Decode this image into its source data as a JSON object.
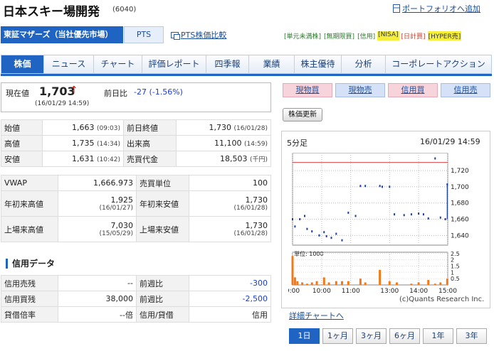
{
  "header": {
    "title": "日本スキー場開発",
    "code": "(6040)",
    "portfolio_link": "ポートフォリオへ追加"
  },
  "market": {
    "tab": "東証マザーズ（当社優先市場）",
    "pts_tab": "PTS",
    "pts_compare": "PTS株価比較"
  },
  "badges": [
    {
      "label": "[単元未満株]",
      "style": "g"
    },
    {
      "label": "[無期限買]",
      "style": "g"
    },
    {
      "label": "[信用]",
      "style": "g"
    },
    {
      "label": "[NISA]",
      "style": "y"
    },
    {
      "label": "[日計買]",
      "style": "r"
    },
    {
      "label": "[HYPER売]",
      "style": "y"
    }
  ],
  "nav": [
    "株価",
    "ニュース",
    "チャート",
    "評価レポート",
    "四季報",
    "業績",
    "株主優待",
    "分析",
    "コーポレートアクション"
  ],
  "price": {
    "label": "現在値",
    "value": "1,703",
    "arrow": "↑",
    "time": "(16/01/29 14:59)",
    "change_label": "前日比",
    "change_value": "-27 (-1.56%)"
  },
  "trade_buttons": {
    "spot_buy": "現物買",
    "spot_sell": "現物売",
    "margin_buy": "信用買",
    "margin_sell": "信用売"
  },
  "refresh": "株価更新",
  "quote_table": [
    {
      "l1": "始値",
      "v1": "1,663",
      "t1": "(09:03)",
      "l2": "前日終値",
      "v2": "1,730",
      "t2": "(16/01/28)"
    },
    {
      "l1": "高値",
      "v1": "1,735",
      "t1": "(14:34)",
      "l2": "出来高",
      "v2": "11,100",
      "t2": "(14:59)"
    },
    {
      "l1": "安値",
      "v1": "1,631",
      "t1": "(10:42)",
      "l2": "売買代金",
      "v2": "18,503",
      "t2": "(千円)"
    }
  ],
  "stats": {
    "vwap_label": "VWAP",
    "vwap": "1,666.973",
    "unit_label": "売買単位",
    "unit": "100",
    "ytd_high_label": "年初来高値",
    "ytd_high": "1,925",
    "ytd_high_date": "(16/01/27)",
    "ytd_low_label": "年初来安値",
    "ytd_low": "1,730",
    "ytd_low_date": "(16/01/28)",
    "listed_high_label": "上場来高値",
    "listed_high": "7,030",
    "listed_high_date": "(15/05/29)",
    "listed_low_label": "上場来安値",
    "listed_low": "1,730",
    "listed_low_date": "(16/01/28)"
  },
  "credit": {
    "heading": "信用データ",
    "sell_label": "信用売残",
    "sell": "--",
    "sell_wow_label": "前週比",
    "sell_wow": "-300",
    "buy_label": "信用買残",
    "buy": "38,000",
    "buy_wow_label": "前週比",
    "buy_wow": "-2,500",
    "ratio_label": "貸借倍率",
    "ratio": "--倍",
    "lend_label": "信用/貸借",
    "lend": "信用"
  },
  "chart": {
    "interval": "5分足",
    "datetime": "16/01/29 14:59",
    "copyright": "(c)Quants Research Inc.",
    "detail_link": "詳細チャートへ",
    "periods": [
      "1日",
      "1ヶ月",
      "3ヶ月",
      "6ヶ月",
      "1年",
      "3年"
    ],
    "active_period": "1日"
  },
  "chart_data": {
    "type": "line",
    "price_ticks": [
      "1,720",
      "1,700",
      "1,680",
      "1,660",
      "1,640"
    ],
    "price_range": [
      1628,
      1742
    ],
    "prev_close": 1730,
    "volume_label": "単位: 1000",
    "volume_ticks": [
      "2.5",
      "2",
      "1.5",
      "1",
      "0.5"
    ],
    "volume_range": [
      0,
      2.6
    ],
    "x_ticks": [
      "9:00",
      "10:00",
      "11:00",
      "13:00",
      "14:00",
      "15:00"
    ],
    "price_points": [
      {
        "t": "09:00",
        "p": 1660
      },
      {
        "t": "09:05",
        "p": 1651
      },
      {
        "t": "09:15",
        "p": 1660
      },
      {
        "t": "09:25",
        "p": 1664
      },
      {
        "t": "09:30",
        "p": 1648
      },
      {
        "t": "09:40",
        "p": 1645
      },
      {
        "t": "09:55",
        "p": 1640
      },
      {
        "t": "10:05",
        "p": 1644
      },
      {
        "t": "10:10",
        "p": 1639
      },
      {
        "t": "10:20",
        "p": 1637
      },
      {
        "t": "10:30",
        "p": 1642
      },
      {
        "t": "10:42",
        "p": 1634
      },
      {
        "t": "10:55",
        "p": 1668
      },
      {
        "t": "11:10",
        "p": 1664
      },
      {
        "t": "11:20",
        "p": 1701
      },
      {
        "t": "11:30",
        "p": 1701
      },
      {
        "t": "12:40",
        "p": 1701
      },
      {
        "t": "12:45",
        "p": 1700
      },
      {
        "t": "13:00",
        "p": 1700
      },
      {
        "t": "13:10",
        "p": 1666
      },
      {
        "t": "13:30",
        "p": 1665
      },
      {
        "t": "13:45",
        "p": 1666
      },
      {
        "t": "14:00",
        "p": 1667
      },
      {
        "t": "14:10",
        "p": 1666
      },
      {
        "t": "14:20",
        "p": 1661
      },
      {
        "t": "14:34",
        "p": 1735
      },
      {
        "t": "14:45",
        "p": 1662
      },
      {
        "t": "14:55",
        "p": 1660
      },
      {
        "t": "14:59",
        "p": 1703
      }
    ],
    "volume_points": [
      {
        "t": "09:00",
        "v": 2.3
      },
      {
        "t": "09:05",
        "v": 0.6
      },
      {
        "t": "09:10",
        "v": 0.3
      },
      {
        "t": "09:20",
        "v": 0.2
      },
      {
        "t": "09:30",
        "v": 0.1
      },
      {
        "t": "09:40",
        "v": 0.2
      },
      {
        "t": "09:50",
        "v": 0.3
      },
      {
        "t": "10:05",
        "v": 0.6
      },
      {
        "t": "10:15",
        "v": 0.2
      },
      {
        "t": "10:30",
        "v": 0.3
      },
      {
        "t": "10:42",
        "v": 0.3
      },
      {
        "t": "10:55",
        "v": 0.3
      },
      {
        "t": "11:20",
        "v": 0.5
      },
      {
        "t": "11:30",
        "v": 0.2
      },
      {
        "t": "12:40",
        "v": 1.2
      },
      {
        "t": "13:00",
        "v": 0.3
      },
      {
        "t": "13:15",
        "v": 0.2
      },
      {
        "t": "13:45",
        "v": 0.1
      },
      {
        "t": "14:00",
        "v": 0.2
      },
      {
        "t": "14:20",
        "v": 0.4
      },
      {
        "t": "14:34",
        "v": 0.1
      },
      {
        "t": "14:45",
        "v": 0.2
      },
      {
        "t": "14:59",
        "v": 0.5
      }
    ]
  }
}
